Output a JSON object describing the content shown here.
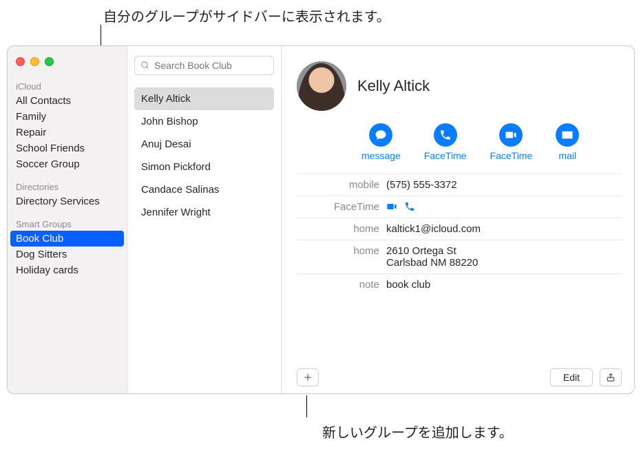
{
  "callouts": {
    "top": "自分のグループがサイドバーに表示されます。",
    "bottom": "新しいグループを追加します。"
  },
  "sidebar": {
    "sections": [
      {
        "header": "iCloud",
        "items": [
          {
            "label": "All Contacts"
          },
          {
            "label": "Family"
          },
          {
            "label": "Repair"
          },
          {
            "label": "School Friends"
          },
          {
            "label": "Soccer Group"
          }
        ]
      },
      {
        "header": "Directories",
        "items": [
          {
            "label": "Directory Services"
          }
        ]
      },
      {
        "header": "Smart Groups",
        "items": [
          {
            "label": "Book Club",
            "selected": true
          },
          {
            "label": "Dog Sitters"
          },
          {
            "label": "Holiday cards"
          }
        ]
      }
    ]
  },
  "search": {
    "placeholder": "Search Book Club"
  },
  "contacts": [
    {
      "name": "Kelly Altick",
      "selected": true
    },
    {
      "name": "John Bishop"
    },
    {
      "name": "Anuj Desai"
    },
    {
      "name": "Simon Pickford"
    },
    {
      "name": "Candace Salinas"
    },
    {
      "name": "Jennifer Wright"
    }
  ],
  "detail": {
    "name": "Kelly Altick",
    "actions": [
      {
        "id": "message",
        "label": "message"
      },
      {
        "id": "facetime-audio",
        "label": "FaceTime"
      },
      {
        "id": "facetime-video",
        "label": "FaceTime"
      },
      {
        "id": "mail",
        "label": "mail"
      }
    ],
    "fields": [
      {
        "label": "mobile",
        "value": "(575) 555-3372",
        "type": "text"
      },
      {
        "label": "FaceTime",
        "type": "facetime"
      },
      {
        "label": "home",
        "value": "kaltick1@icloud.com",
        "type": "text"
      },
      {
        "label": "home",
        "value": "2610 Ortega St\nCarlsbad NM 88220",
        "type": "text"
      },
      {
        "label": "note",
        "value": "book club",
        "type": "text"
      }
    ],
    "edit_label": "Edit"
  }
}
